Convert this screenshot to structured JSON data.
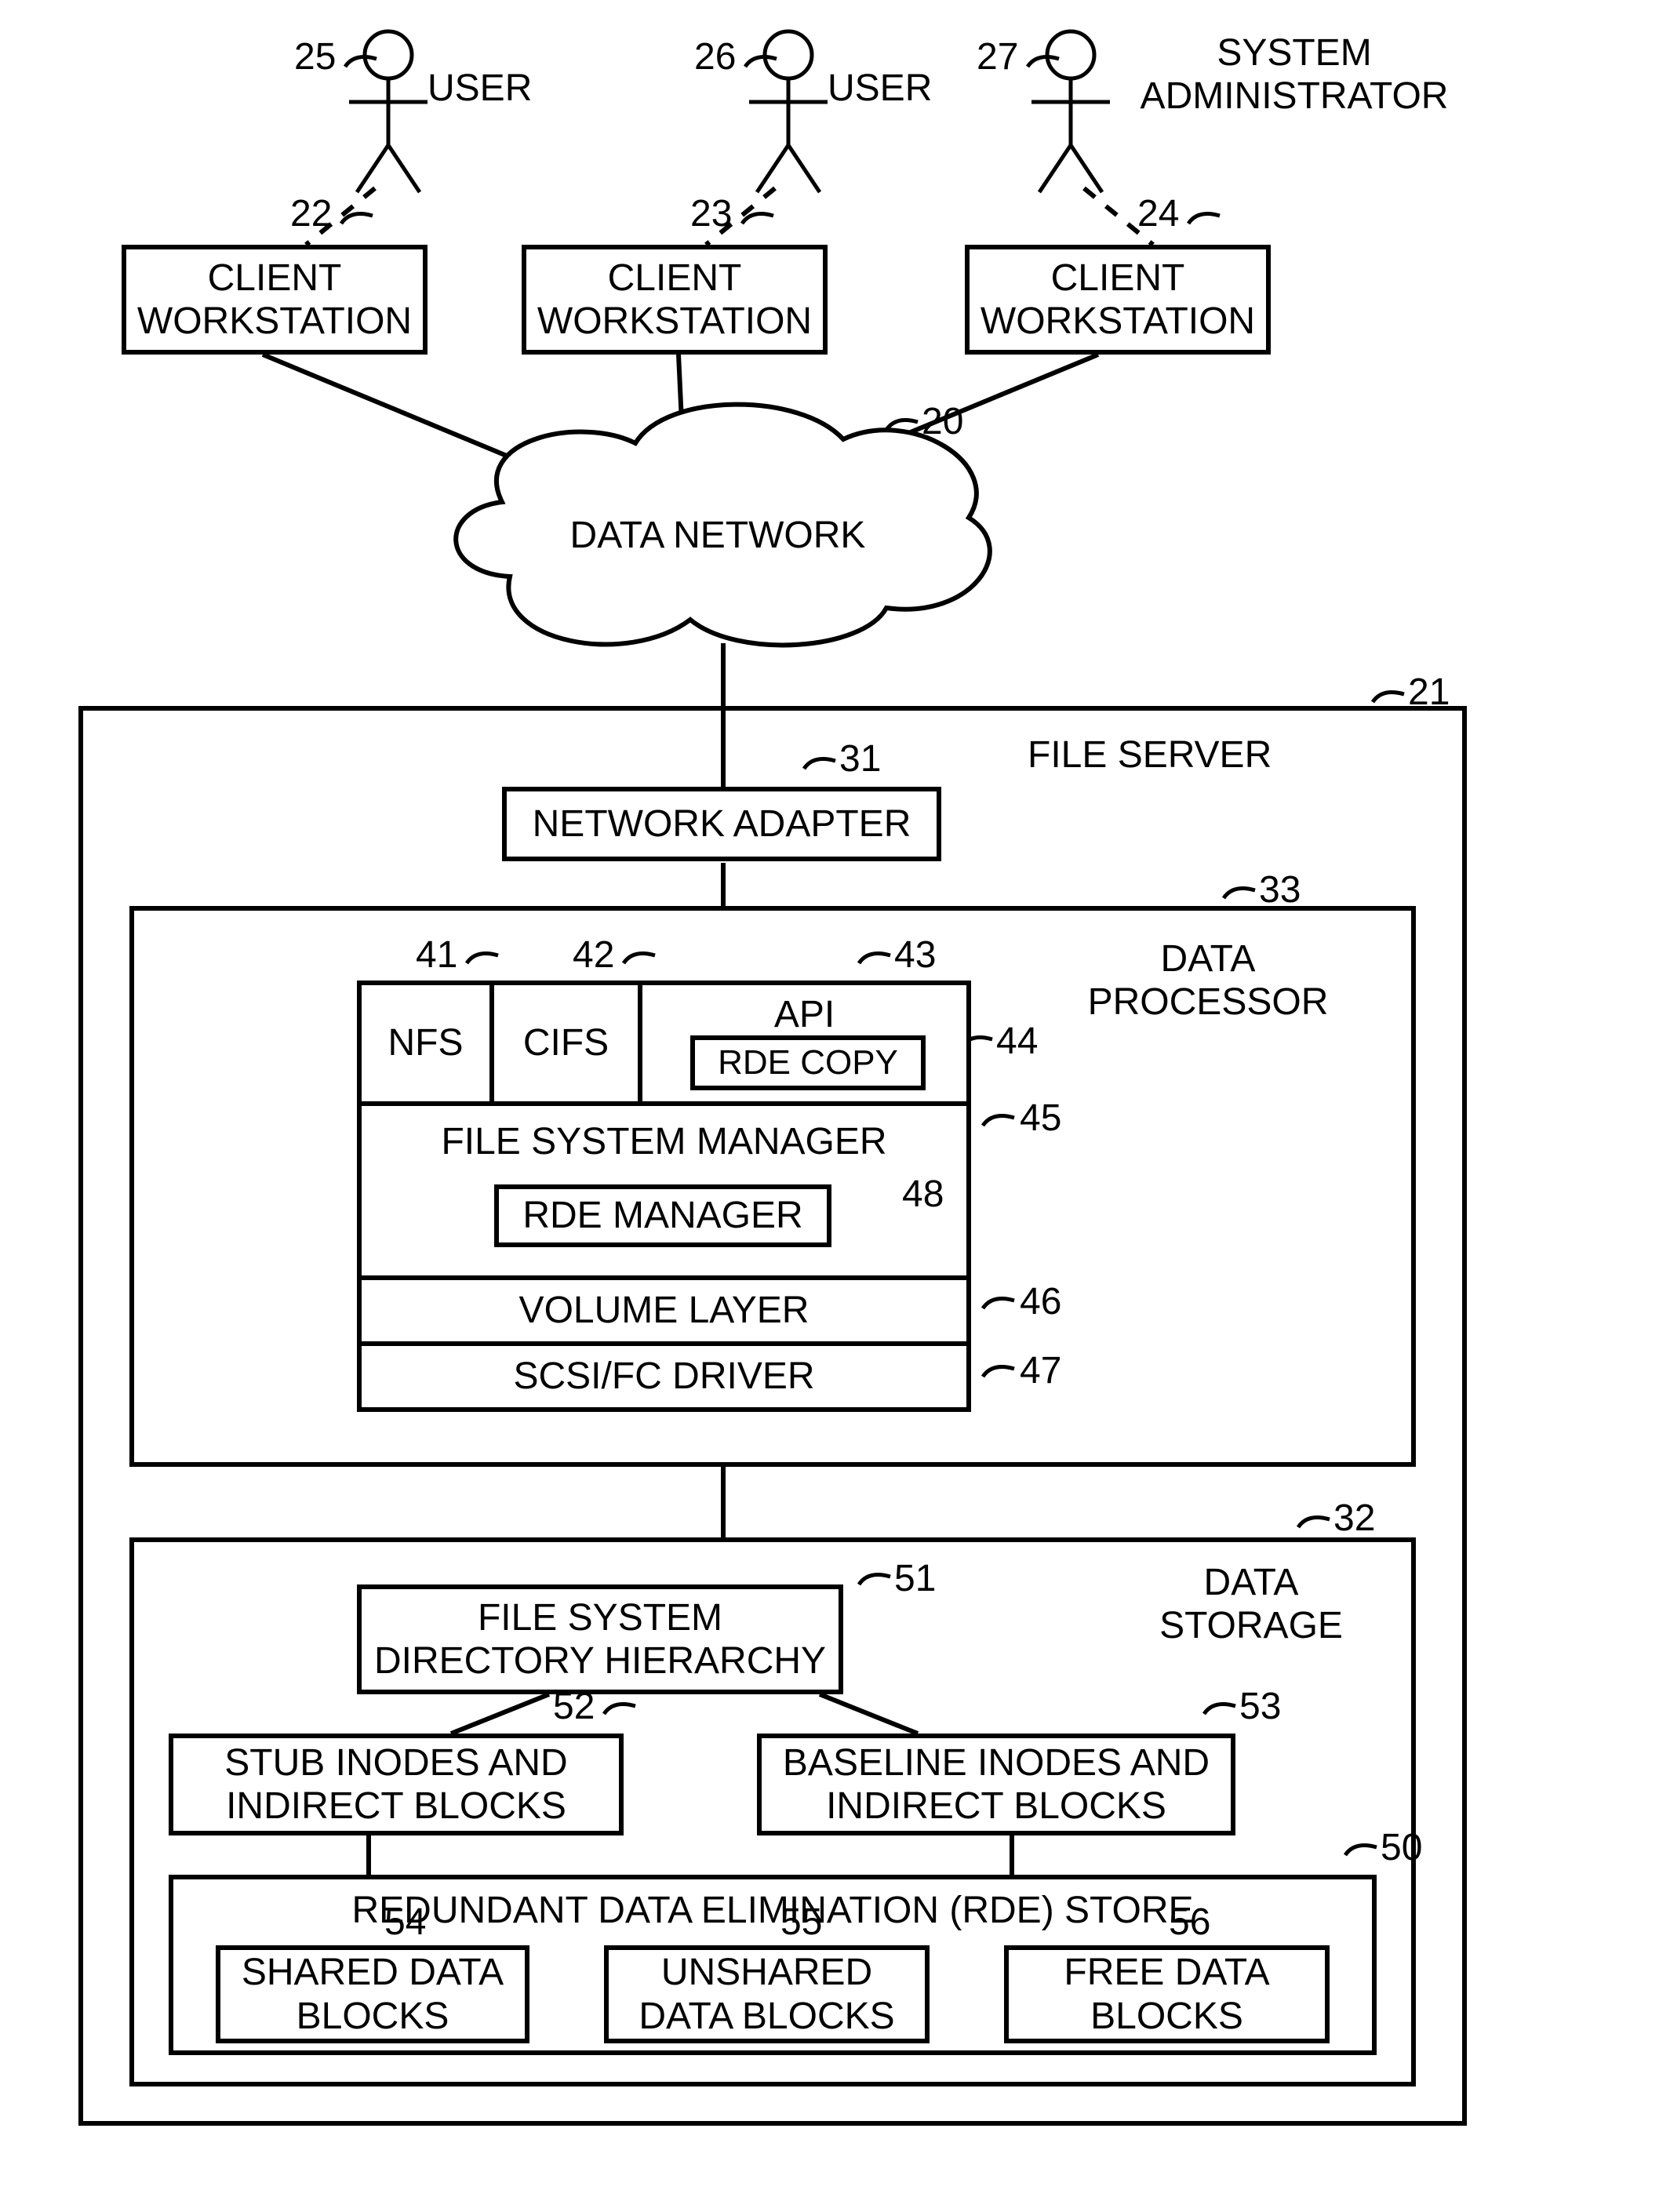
{
  "actors": {
    "a1": {
      "num": "25",
      "role": "USER"
    },
    "a2": {
      "num": "26",
      "role": "USER"
    },
    "a3": {
      "num": "27",
      "role": "SYSTEM\nADMINISTRATOR"
    }
  },
  "clients": {
    "c1": {
      "num": "22",
      "label": "CLIENT\nWORKSTATION"
    },
    "c2": {
      "num": "23",
      "label": "CLIENT\nWORKSTATION"
    },
    "c3": {
      "num": "24",
      "label": "CLIENT\nWORKSTATION"
    }
  },
  "network": {
    "num": "20",
    "label": "DATA NETWORK"
  },
  "server": {
    "num": "21",
    "label": "FILE SERVER",
    "adapter": {
      "num": "31",
      "label": "NETWORK ADAPTER"
    },
    "processor": {
      "num": "33",
      "label": "DATA\nPROCESSOR",
      "nfs": {
        "num": "41",
        "label": "NFS"
      },
      "cifs": {
        "num": "42",
        "label": "CIFS"
      },
      "api": {
        "num": "43",
        "label": "API"
      },
      "rde_copy": {
        "num": "44",
        "label": "RDE COPY"
      },
      "fsm": {
        "num": "45",
        "label": "FILE SYSTEM MANAGER"
      },
      "rde_mgr": {
        "num": "48",
        "label": "RDE MANAGER"
      },
      "vol": {
        "num": "46",
        "label": "VOLUME LAYER"
      },
      "drv": {
        "num": "47",
        "label": "SCSI/FC DRIVER"
      }
    },
    "storage": {
      "num": "32",
      "label": "DATA\nSTORAGE",
      "fsdir": {
        "num": "51",
        "label": "FILE SYSTEM\nDIRECTORY HIERARCHY"
      },
      "stub": {
        "num": "52",
        "label": "STUB INODES AND\nINDIRECT BLOCKS"
      },
      "base": {
        "num": "53",
        "label": "BASELINE  INODES AND\nINDIRECT BLOCKS"
      },
      "rde_store": {
        "num": "50",
        "label": "REDUNDANT DATA ELIMINATION (RDE)  STORE"
      },
      "shared": {
        "num": "54",
        "label": "SHARED\nDATA BLOCKS"
      },
      "unshared": {
        "num": "55",
        "label": "UNSHARED\nDATA BLOCKS"
      },
      "free": {
        "num": "56",
        "label": "FREE\nDATA BLOCKS"
      }
    }
  }
}
